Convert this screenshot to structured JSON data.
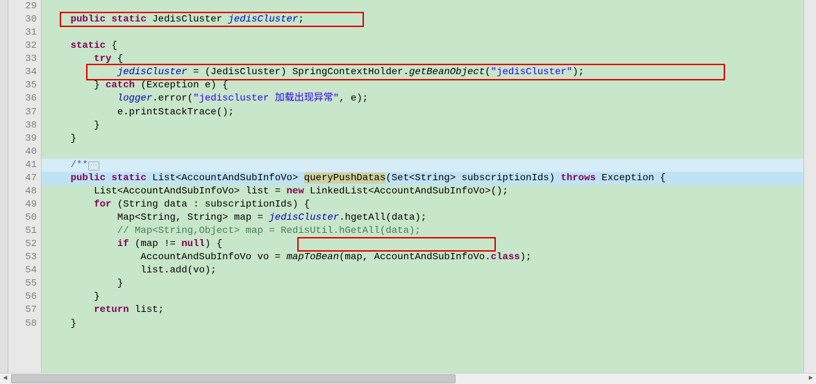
{
  "gutter": [
    "29",
    "30",
    "31",
    "32",
    "33",
    "34",
    "35",
    "36",
    "37",
    "38",
    "39",
    "40",
    "41",
    "47",
    "48",
    "49",
    "50",
    "51",
    "52",
    "53",
    "54",
    "55",
    "56",
    "57",
    "58"
  ],
  "fold_plus_line": "41",
  "code": {
    "l30": {
      "kw1": "public",
      "kw2": "static",
      "type": "JedisCluster",
      "var": "jedisCluster",
      "semi": ";"
    },
    "l32": {
      "kw": "static",
      "brace": "{"
    },
    "l33": {
      "kw": "try",
      "brace": "{"
    },
    "l34": {
      "var": "jedisCluster",
      "eq": " = (",
      "type": "JedisCluster",
      "close": ") ",
      "cls": "SpringContextHolder",
      "dot": ".",
      "method": "getBeanObject",
      "op": "(",
      "str": "\"jedisCluster\"",
      "cl": ");"
    },
    "l35": {
      "close": "} ",
      "kw": "catch",
      "open": " (",
      "type": "Exception",
      "var": " e",
      "close2": ") {"
    },
    "l36": {
      "var": "logger",
      "dot": ".",
      "method": "error",
      "op": "(",
      "str": "\"jediscluster 加载出现异常\"",
      "comma": ", ",
      "arg": "e",
      "cl": ");"
    },
    "l37": {
      "var": "e",
      "dot": ".",
      "method": "printStackTrace",
      "call": "();"
    },
    "l38": {
      "close": "}"
    },
    "l39": {
      "close": "}"
    },
    "l41": {
      "doc": "/**",
      "ellipsis": "⋯"
    },
    "l47": {
      "kw1": "public",
      "kw2": "static",
      "type1": "List",
      "lt": "<",
      "type2": "AccountAndSubInfoVo",
      "gt": "> ",
      "method": "queryPushDatas",
      "op": "(",
      "type3": "Set",
      "lt2": "<",
      "type4": "String",
      "gt2": "> ",
      "param": "subscriptionIds",
      "cl": ") ",
      "kw3": "throws",
      "type5": " Exception",
      "brace": " {"
    },
    "l48": {
      "type1": "List",
      "lt": "<",
      "type2": "AccountAndSubInfoVo",
      "gt": "> ",
      "var": "list",
      "eq": " = ",
      "kw": "new",
      "sp": " ",
      "type3": "LinkedList",
      "lt2": "<",
      "type4": "AccountAndSubInfoVo",
      "gt2": ">",
      "call": "();"
    },
    "l49": {
      "kw": "for",
      "open": " (",
      "type": "String",
      "var": " data",
      ":": " : ",
      "param": "subscriptionIds",
      "close": ") {"
    },
    "l50": {
      "type1": "Map",
      "lt": "<",
      "type2": "String",
      "comma": ", ",
      "type3": "String",
      "gt": "> ",
      "var": "map",
      "eq": " = ",
      "jedis": "jedisCluster",
      "dot": ".",
      "method": "hgetAll",
      "op": "(",
      "arg": "data",
      "cl": ");"
    },
    "l51": {
      "comment": "// Map<String,Object> map = RedisUtil.hGetAll(data);"
    },
    "l52": {
      "kw": "if",
      "open": " (",
      "var": "map",
      "neq": " != ",
      "kw2": "null",
      "close": ") {"
    },
    "l53": {
      "type": "AccountAndSubInfoVo",
      "var": " vo",
      "eq": " = ",
      "method": "mapToBean",
      "op": "(",
      "arg1": "map",
      "comma": ", ",
      "type2": "AccountAndSubInfoVo",
      "dot": ".",
      "kw": "class",
      "cl": ");"
    },
    "l54": {
      "var": "list",
      "dot": ".",
      "method": "add",
      "op": "(",
      "arg": "vo",
      "cl": ");"
    },
    "l55": {
      "close": "}"
    },
    "l56": {
      "close": "}"
    },
    "l57": {
      "kw": "return",
      "var": " list",
      "semi": ";"
    },
    "l58": {
      "close": "}"
    }
  }
}
